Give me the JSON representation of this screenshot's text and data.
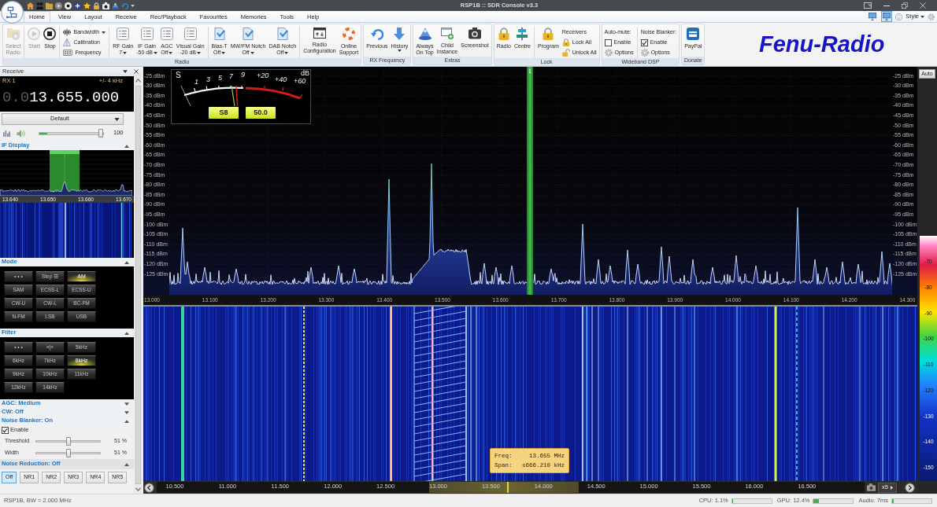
{
  "window": {
    "title": "RSP1B :: SDR Console v3.3"
  },
  "tabs": [
    {
      "label": "Home",
      "selected": true
    },
    {
      "label": "View",
      "selected": false
    },
    {
      "label": "Layout",
      "selected": false
    },
    {
      "label": "Receive",
      "selected": false
    },
    {
      "label": "Rec/Playback",
      "selected": false
    },
    {
      "label": "Favourites",
      "selected": false
    },
    {
      "label": "Memories",
      "selected": false
    },
    {
      "label": "Tools",
      "selected": false
    },
    {
      "label": "Help",
      "selected": false
    }
  ],
  "view_modes": [
    {
      "selected": false
    },
    {
      "selected": true
    }
  ],
  "style_menu": {
    "label": "Style"
  },
  "ribbon": {
    "groups": [
      {
        "label": "Radio",
        "sections": [
          [
            {
              "kind": "large",
              "label": "Select\nRadio",
              "disabled": true,
              "dropdown": false
            }
          ],
          [
            {
              "kind": "large",
              "label": "Start",
              "disabled": true,
              "dropdown": false
            },
            {
              "kind": "large",
              "label": "Stop",
              "disabled": false,
              "dropdown": false
            }
          ],
          [
            {
              "kind": "stack",
              "entries": [
                {
                  "kind": "command",
                  "label": "Bandwidth",
                  "dropdown": true
                },
                {
                  "kind": "command",
                  "label": "Calibration",
                  "dropdown": false
                },
                {
                  "kind": "command",
                  "label": "Frequency",
                  "dropdown": false
                }
              ]
            }
          ],
          [
            {
              "kind": "large",
              "label": "RF Gain",
              "value": "7",
              "disabled": false,
              "dropdown": true
            },
            {
              "kind": "large",
              "label": "IF Gain",
              "value": "-50 dB",
              "disabled": false,
              "dropdown": true
            },
            {
              "kind": "large",
              "label": "AGC",
              "value": "Off",
              "disabled": false,
              "dropdown": true
            },
            {
              "kind": "large",
              "label": "Visual Gain",
              "value": "-20 dB",
              "disabled": false,
              "dropdown": true
            }
          ],
          [
            {
              "kind": "large",
              "label": "Bias-T",
              "value": "Off",
              "disabled": false,
              "dropdown": true
            },
            {
              "kind": "large",
              "label": "MW/FM Notch",
              "value": "Off",
              "disabled": false,
              "dropdown": true
            },
            {
              "kind": "large",
              "label": "DAB Notch",
              "value": "Off",
              "disabled": false,
              "dropdown": true
            }
          ],
          [
            {
              "kind": "large",
              "label": "Radio\nConfiguration",
              "disabled": false,
              "dropdown": false
            },
            {
              "kind": "large",
              "label": "Online\nSupport",
              "disabled": false,
              "dropdown": false
            }
          ]
        ]
      },
      {
        "label": "RX Frequency",
        "sections": [
          [
            {
              "kind": "large",
              "label": "Previous",
              "disabled": false,
              "dropdown": false
            },
            {
              "kind": "large",
              "label": "History",
              "disabled": false,
              "dropdown": true
            }
          ]
        ]
      },
      {
        "label": "Extras",
        "sections": [
          [
            {
              "kind": "large",
              "label": "Always\nOn Top",
              "disabled": false,
              "dropdown": false
            },
            {
              "kind": "large",
              "label": "Child\nInstance",
              "disabled": false,
              "dropdown": false
            },
            {
              "kind": "large",
              "label": "Screenshot",
              "disabled": false,
              "dropdown": false
            }
          ]
        ]
      },
      {
        "label": "Lock",
        "sections": [
          [
            {
              "kind": "large",
              "label": "Radio",
              "disabled": false,
              "dropdown": false
            },
            {
              "kind": "large",
              "label": "Centre",
              "disabled": false,
              "dropdown": false
            }
          ],
          [
            {
              "kind": "large",
              "label": "Program",
              "disabled": false,
              "dropdown": false
            },
            {
              "kind": "stack",
              "entries": [
                {
                  "kind": "heading",
                  "label": "Receivers"
                },
                {
                  "kind": "command",
                  "label": "Lock All",
                  "dropdown": false
                },
                {
                  "kind": "command",
                  "label": "Unlock All",
                  "dropdown": false
                }
              ]
            }
          ]
        ]
      },
      {
        "label": "Wideband DSP",
        "sections": [
          [
            {
              "kind": "stack",
              "entries": [
                {
                  "kind": "heading",
                  "label": "Auto-mute:"
                },
                {
                  "kind": "checkbox",
                  "label": "Enable",
                  "checked": false
                },
                {
                  "kind": "command",
                  "label": "Options",
                  "dropdown": false
                }
              ]
            }
          ],
          [
            {
              "kind": "stack",
              "entries": [
                {
                  "kind": "heading",
                  "label": "Noise Blanker:"
                },
                {
                  "kind": "checkbox",
                  "label": "Enable",
                  "checked": true
                },
                {
                  "kind": "command",
                  "label": "Options",
                  "dropdown": false
                }
              ]
            }
          ]
        ]
      },
      {
        "label": "Donate",
        "sections": [
          [
            {
              "kind": "large",
              "label": "PayPal",
              "disabled": false,
              "dropdown": false
            }
          ]
        ]
      }
    ]
  },
  "brand": {
    "text": "Fenu-Radio"
  },
  "receive_panel": {
    "title": "Receive",
    "receiver": "RX 1",
    "bandwidth": "+/- 4 kHz",
    "frequency": "0.013.655.000",
    "preset": "Default",
    "meter": {
      "level": 0.12
    },
    "volume": {
      "level": 0.96,
      "reading": "100"
    },
    "sections": [
      {
        "kind": "if_display",
        "title": "IF Display",
        "expanded": true,
        "freq_labels": [
          "13.640",
          "13.650",
          "13.660",
          "13.670"
        ]
      },
      {
        "kind": "buttons",
        "title": "Mode",
        "expanded": true,
        "buttons": [
          {
            "label": "• • •",
            "selected": false
          },
          {
            "label": "Step ☰",
            "selected": false
          },
          {
            "label": "AM",
            "selected": true
          },
          {
            "label": "SAM",
            "selected": false
          },
          {
            "label": "ECSS-L",
            "selected": false
          },
          {
            "label": "ECSS-U",
            "selected": false
          },
          {
            "label": "CW-U",
            "selected": false
          },
          {
            "label": "CW-L",
            "selected": false
          },
          {
            "label": "BC-FM",
            "selected": false
          },
          {
            "label": "N-FM",
            "selected": false
          },
          {
            "label": "LSB",
            "selected": false
          },
          {
            "label": "USB",
            "selected": false
          }
        ]
      },
      {
        "kind": "buttons",
        "title": "Filter",
        "expanded": true,
        "buttons": [
          {
            "label": "• • •",
            "selected": false
          },
          {
            "label": "«|»",
            "selected": false
          },
          {
            "label": "5kHz",
            "selected": false
          },
          {
            "label": "6kHz",
            "selected": false
          },
          {
            "label": "7kHz",
            "selected": false
          },
          {
            "label": "8kHz",
            "selected": true
          },
          {
            "label": "9kHz",
            "selected": false
          },
          {
            "label": "10kHz",
            "selected": false
          },
          {
            "label": "11kHz",
            "selected": false
          },
          {
            "label": "12kHz",
            "selected": false
          },
          {
            "label": "14kHz",
            "selected": false
          }
        ]
      },
      {
        "kind": "header",
        "title": "AGC: Medium",
        "expanded": false
      },
      {
        "kind": "header",
        "title": "CW: Off",
        "expanded": false
      },
      {
        "kind": "blanker",
        "title": "Noise Blanker: On",
        "expanded": true,
        "enable": {
          "label": "Enable",
          "checked": true
        },
        "sliders": [
          {
            "label": "Threshold",
            "level": 0.51,
            "reading": "51 %"
          },
          {
            "label": "Width",
            "level": 0.51,
            "reading": "51 %"
          }
        ]
      },
      {
        "kind": "toggles",
        "title": "Noise Reduction: Off",
        "expanded": true,
        "buttons": [
          {
            "label": "Off",
            "selected": true
          },
          {
            "label": "NR1",
            "selected": false
          },
          {
            "label": "NR2",
            "selected": false
          },
          {
            "label": "NR3",
            "selected": false
          },
          {
            "label": "NR4",
            "selected": false
          },
          {
            "label": "NR5",
            "selected": false
          }
        ]
      }
    ]
  },
  "spectrum": {
    "dbm_labels_left": [
      "-25 dBm",
      "-30 dBm",
      "-35 dBm",
      "-40 dBm",
      "-45 dBm",
      "-50 dBm",
      "-55 dBm",
      "-60 dBm",
      "-65 dBm",
      "-70 dBm",
      "-75 dBm",
      "-80 dBm",
      "-85 dBm",
      "-90 dBm",
      "-95 dBm",
      "-100 dBm",
      "-105 dBm",
      "-110 dBm",
      "-115 dBm",
      "-120 dBm",
      "-125 dBm"
    ],
    "dbm_labels_right": [
      "-25 dBm",
      "-30 dBm",
      "-35 dBm",
      "-40 dBm",
      "-45 dBm",
      "-50 dBm",
      "-55 dBm",
      "-60 dBm",
      "-65 dBm",
      "-70 dBm",
      "-75 dBm",
      "-80 dBm",
      "-85 dBm",
      "-90 dBm",
      "-95 dBm",
      "-100 dBm",
      "-105 dBm",
      "-110 dBm",
      "-115 dBm",
      "-120 dBm",
      "-125 dBm"
    ],
    "freq_labels": [
      "13.000",
      "13.100",
      "13.200",
      "13.300",
      "13.400",
      "13.500",
      "13.600",
      "13.700",
      "13.800",
      "13.900",
      "14.000",
      "14.100",
      "14.200",
      "14.300"
    ],
    "marker": {
      "label": "1"
    },
    "s_meter": {
      "scale_labels": [
        "S",
        "1",
        "3",
        "5",
        "7",
        "9",
        "+20",
        "+40",
        "+60",
        "dB"
      ],
      "reading": "S8",
      "value": "50.0"
    }
  },
  "waterfall": {
    "tooltip": [
      {
        "label": "Freq:",
        "value": "13.655 MHz"
      },
      {
        "label": "Span:",
        "value": "±666.210 kHz"
      }
    ]
  },
  "overview": {
    "freq_labels": [
      "10.500",
      "11.000",
      "11.500",
      "12.000",
      "12.500",
      "13.000",
      "13.500",
      "14.000",
      "14.500",
      "15.000",
      "15.500",
      "16.000",
      "16.500"
    ],
    "zoom": "x5"
  },
  "level_scale": {
    "button": "Auto",
    "labels": [
      "-70",
      "-80",
      "-90",
      "-100",
      "-110",
      "-120",
      "-130",
      "-140",
      "-150"
    ]
  },
  "status_bar": {
    "text": "RSP1B, BW = 2.000 MHz",
    "meters": [
      {
        "label": "CPU: 1.1%",
        "level": 0.011
      },
      {
        "label": "GPU: 12.4%",
        "level": 0.124
      },
      {
        "label": "Audio: 7ms",
        "level": 0.03
      }
    ]
  }
}
